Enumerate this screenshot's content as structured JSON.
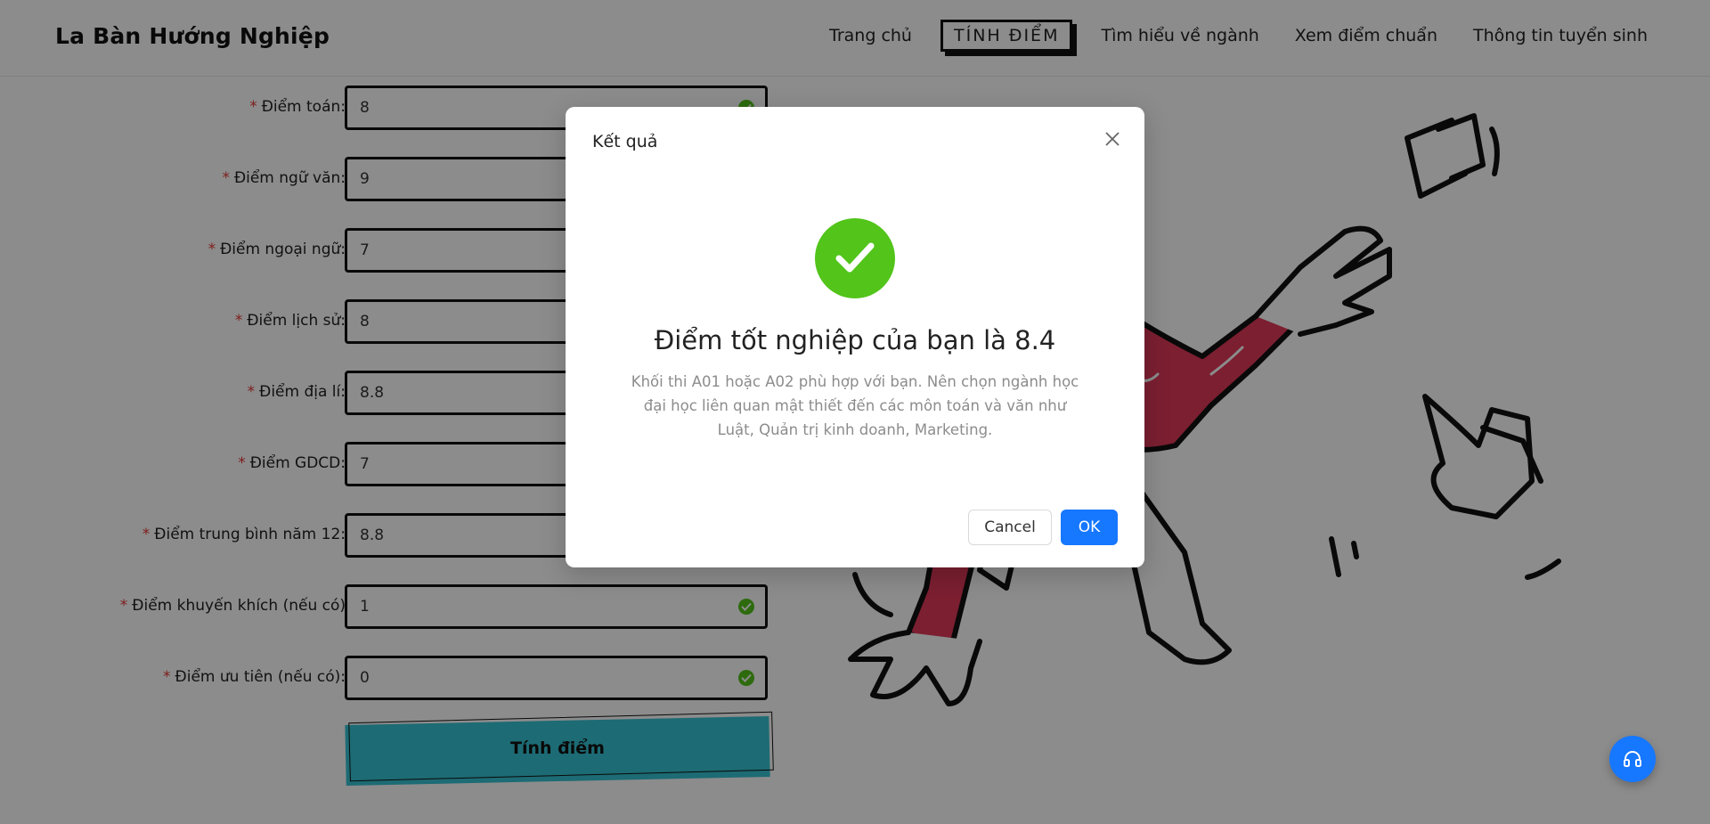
{
  "header": {
    "brand": "La Bàn Hướng Nghiệp",
    "nav": [
      {
        "label": "Trang chủ"
      },
      {
        "label": "TÍNH ĐIỂM"
      },
      {
        "label": "Tìm hiểu về ngành"
      },
      {
        "label": "Xem điểm chuẩn"
      },
      {
        "label": "Thông tin tuyển sinh"
      }
    ]
  },
  "form": {
    "required_mark": "*",
    "fields": [
      {
        "label": "Điểm toán:",
        "value": "8"
      },
      {
        "label": "Điểm ngữ văn:",
        "value": "9"
      },
      {
        "label": "Điểm ngoại ngữ:",
        "value": "7"
      },
      {
        "label": "Điểm lịch sử:",
        "value": "8"
      },
      {
        "label": "Điểm địa lí:",
        "value": "8.8"
      },
      {
        "label": "Điểm GDCD:",
        "value": "7"
      },
      {
        "label": "Điểm trung bình năm 12:",
        "value": "8.8"
      },
      {
        "label": "Điểm khuyến khích (nếu có)",
        "value": "1"
      },
      {
        "label": "Điểm ưu tiên (nếu có):",
        "value": "0"
      }
    ],
    "submit_label": "Tính điểm"
  },
  "modal": {
    "title": "Kết quả",
    "result_title": "Điểm tốt nghiệp của bạn là 8.4",
    "result_desc": "Khối thi A01 hoặc A02 phù hợp với bạn. Nên chọn ngành học đại học liên quan mật thiết đến các môn toán và văn như Luật, Quản trị kinh doanh, Marketing.",
    "cancel_label": "Cancel",
    "ok_label": "OK"
  },
  "colors": {
    "success": "#52c41a",
    "primary": "#1677ff",
    "accent_button": "#36c3d4",
    "illustration_shirt": "#e0395a",
    "required": "#e53935"
  },
  "icons": {
    "close": "close-icon",
    "success": "check-circle-icon",
    "valid": "check-circle-small-icon",
    "support": "headphones-icon"
  }
}
